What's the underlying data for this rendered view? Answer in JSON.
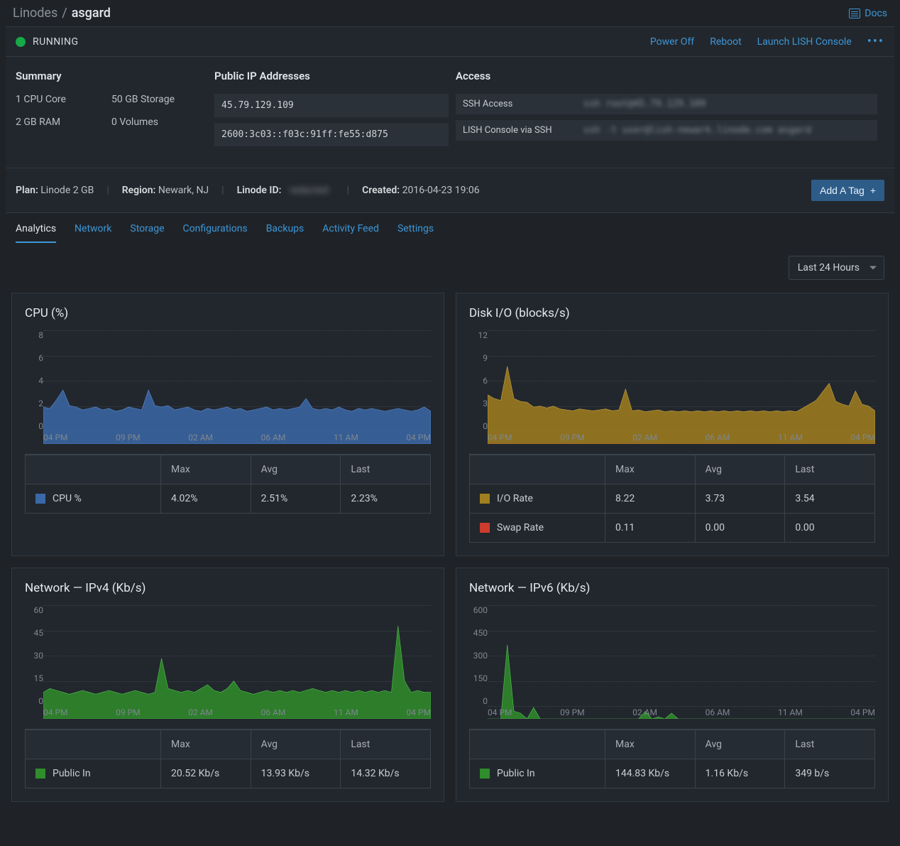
{
  "breadcrumb": {
    "root": "Linodes",
    "sep": "/",
    "name": "asgard"
  },
  "docs_link": "Docs",
  "status": {
    "label": "RUNNING",
    "actions": {
      "power_off": "Power Off",
      "reboot": "Reboot",
      "lish": "Launch LISH Console"
    }
  },
  "summary": {
    "title": "Summary",
    "items": {
      "cpu": "1 CPU Core",
      "storage": "50 GB Storage",
      "ram": "2 GB RAM",
      "volumes": "0 Volumes"
    }
  },
  "public_ip": {
    "title": "Public IP Addresses",
    "v4": "45.79.129.109",
    "v6": "2600:3c03::f03c:91ff:fe55:d875"
  },
  "access": {
    "title": "Access",
    "rows": {
      "ssh": {
        "label": "SSH Access",
        "value": "ssh root@45.79.129.109"
      },
      "lish": {
        "label": "LISH Console via SSH",
        "value": "ssh -t user@lish-newark.linode.com asgard"
      }
    }
  },
  "meta": {
    "plan_label": "Plan:",
    "plan": "Linode 2 GB",
    "region_label": "Region:",
    "region": "Newark, NJ",
    "id_label": "Linode ID:",
    "id": "redacted",
    "created_label": "Created:",
    "created": "2016-04-23 19:06",
    "add_tag": "Add A Tag"
  },
  "tabs": {
    "analytics": "Analytics",
    "network": "Network",
    "storage": "Storage",
    "configurations": "Configurations",
    "backups": "Backups",
    "activity": "Activity Feed",
    "settings": "Settings"
  },
  "range": {
    "selected": "Last 24 Hours"
  },
  "x_ticks": [
    "04 PM",
    "09 PM",
    "02 AM",
    "06 AM",
    "11 AM",
    "04 PM"
  ],
  "colors": {
    "cpu_fill": "#3b69a7",
    "cpu_stroke": "#5e8ed6",
    "io_fill": "#a07f1e",
    "io_stroke": "#c8a544",
    "swap": "#cc3c2c",
    "ipv4_fill": "#2f8d2b",
    "ipv4_stroke": "#55c64f",
    "ipv6_fill": "#2f8d2b",
    "ipv6_stroke": "#55c64f"
  },
  "stats_header": {
    "max": "Max",
    "avg": "Avg",
    "last": "Last"
  },
  "chart_data": [
    {
      "id": "cpu",
      "type": "area",
      "title": "CPU (%)",
      "xlabel": "",
      "ylabel": "",
      "ylim": [
        0,
        8
      ],
      "y_ticks": [
        0,
        2,
        4,
        6,
        8
      ],
      "values": [
        2.6,
        2.5,
        3.1,
        3.8,
        2.7,
        2.6,
        2.4,
        2.5,
        2.6,
        2.4,
        2.5,
        2.3,
        2.4,
        2.6,
        2.5,
        2.4,
        3.8,
        2.7,
        2.6,
        2.7,
        2.4,
        2.5,
        2.6,
        2.4,
        2.3,
        2.5,
        2.4,
        2.5,
        2.6,
        2.4,
        2.5,
        2.3,
        2.4,
        2.5,
        2.6,
        2.4,
        2.5,
        2.4,
        2.5,
        2.6,
        3.2,
        2.5,
        2.4,
        2.5,
        2.4,
        2.6,
        2.4,
        2.3,
        2.5,
        2.4,
        2.5,
        2.4,
        2.3,
        2.4,
        2.5,
        2.4,
        2.3,
        2.4,
        2.6,
        2.3
      ],
      "stats": [
        {
          "name": "CPU %",
          "color": "#3b69a7",
          "max": "4.02%",
          "avg": "2.51%",
          "last": "2.23%"
        }
      ]
    },
    {
      "id": "disk",
      "type": "area",
      "title": "Disk I/O (blocks/s)",
      "ylim": [
        0,
        12
      ],
      "y_ticks": [
        0,
        3,
        6,
        9,
        12
      ],
      "series": [
        {
          "name": "I/O Rate",
          "color_fill": "#a07f1e",
          "color_stroke": "#c8a544",
          "values": [
            5.2,
            4.8,
            4.6,
            8.2,
            4.8,
            4.5,
            4.4,
            3.9,
            4.0,
            3.8,
            4.0,
            3.7,
            3.6,
            3.5,
            3.7,
            3.6,
            3.5,
            3.6,
            3.7,
            3.5,
            3.6,
            5.8,
            3.5,
            3.6,
            3.4,
            3.5,
            3.6,
            3.4,
            3.5,
            3.4,
            3.5,
            3.4,
            3.5,
            3.4,
            3.5,
            3.4,
            3.5,
            3.4,
            3.5,
            3.4,
            3.5,
            3.4,
            3.5,
            3.4,
            3.5,
            3.4,
            3.5,
            3.4,
            3.8,
            4.2,
            4.6,
            5.5,
            6.4,
            4.5,
            4.2,
            4.0,
            5.6,
            4.2,
            4.0,
            3.5
          ]
        },
        {
          "name": "Swap Rate",
          "color_fill": "#cc3c2c",
          "color_stroke": "#cc3c2c",
          "values": [
            0,
            0,
            0,
            0,
            0,
            0,
            0,
            0,
            0,
            0,
            0,
            0,
            0,
            0,
            0,
            0,
            0,
            0,
            0,
            0,
            0,
            0,
            0,
            0,
            0,
            0,
            0,
            0,
            0,
            0,
            0,
            0,
            0,
            0,
            0,
            0,
            0,
            0,
            0,
            0,
            0,
            0,
            0,
            0,
            0,
            0,
            0,
            0,
            0,
            0,
            0,
            0,
            0,
            0,
            0,
            0,
            0,
            0,
            0,
            0
          ]
        }
      ],
      "stats": [
        {
          "name": "I/O Rate",
          "color": "#a07f1e",
          "max": "8.22",
          "avg": "3.73",
          "last": "3.54"
        },
        {
          "name": "Swap Rate",
          "color": "#cc3c2c",
          "max": "0.11",
          "avg": "0.00",
          "last": "0.00"
        }
      ]
    },
    {
      "id": "ipv4",
      "type": "area",
      "title": "Network — IPv4 (Kb/s)",
      "ylim": [
        0,
        60
      ],
      "y_ticks": [
        0,
        15,
        30,
        45,
        60
      ],
      "values": [
        14,
        16,
        15,
        14,
        13,
        14,
        15,
        14,
        13,
        14,
        15,
        14,
        13,
        14,
        15,
        14,
        13,
        14,
        32,
        16,
        15,
        14,
        15,
        14,
        16,
        18,
        15,
        14,
        16,
        20,
        15,
        14,
        13,
        14,
        15,
        14,
        15,
        14,
        15,
        14,
        15,
        16,
        15,
        14,
        15,
        14,
        15,
        14,
        15,
        14,
        15,
        14,
        15,
        14,
        49,
        20,
        14,
        15,
        14,
        14
      ],
      "stats": [
        {
          "name": "Public In",
          "color": "#2f8d2b",
          "max": "20.52 Kb/s",
          "avg": "13.93 Kb/s",
          "last": "14.32 Kb/s"
        }
      ]
    },
    {
      "id": "ipv6",
      "type": "area",
      "title": "Network — IPv6 (Kb/s)",
      "ylim": [
        0,
        600
      ],
      "y_ticks": [
        0,
        150,
        300,
        450,
        600
      ],
      "values": [
        0,
        0,
        0,
        390,
        40,
        30,
        0,
        60,
        0,
        0,
        0,
        0,
        0,
        0,
        0,
        0,
        0,
        0,
        0,
        0,
        0,
        0,
        0,
        0,
        40,
        0,
        10,
        0,
        30,
        0,
        0,
        0,
        0,
        0,
        0,
        0,
        0,
        0,
        0,
        0,
        0,
        0,
        0,
        0,
        0,
        0,
        0,
        0,
        0,
        0,
        0,
        0,
        0,
        0,
        0,
        0,
        0,
        0,
        0,
        0
      ],
      "stats": [
        {
          "name": "Public In",
          "color": "#2f8d2b",
          "max": "144.83 Kb/s",
          "avg": "1.16 Kb/s",
          "last": "349 b/s"
        }
      ]
    }
  ]
}
